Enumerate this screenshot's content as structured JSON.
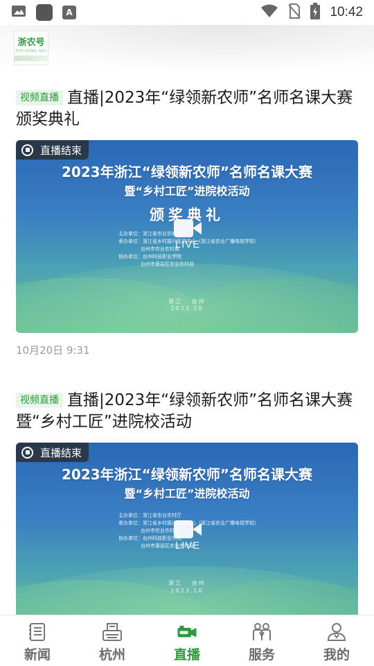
{
  "status_bar": {
    "time": "10:42",
    "icons": [
      "image-icon",
      "square-icon",
      "font-a-icon",
      "wifi-icon",
      "no-sim-icon",
      "battery-charging-icon"
    ],
    "icon_a_glyph": "A"
  },
  "header": {
    "logo_text": "浙农号",
    "logo_sub": "ZHE NONG HAO"
  },
  "feed": {
    "items": [
      {
        "tag": "视频直播",
        "title": "直播|2023年“绿领新农师”名师名课大赛颁奖典礼",
        "badge": "直播结束",
        "video": {
          "line1": "2023年浙江“绿领新农师”名师名课大赛",
          "line2": "暨“乡村工匠”进院校活动",
          "line3": "颁奖典礼",
          "org1": "主办单位：浙江省农业农村厅",
          "org2": "承办单位：浙江省乡村振兴促进中心（浙江省农业广播电视学校）",
          "org3": "台州市农业农村局",
          "org4": "协办单位：台州科技职业学院",
          "org5": "台州市黄岩区农业农村局",
          "place": "浙江 · 台州",
          "date": "2023.10",
          "live": "LIVE"
        },
        "date": "10月20日  9:31"
      },
      {
        "tag": "视频直播",
        "title": "直播|2023年“绿领新农师”名师名课大赛暨“乡村工匠”进院校活动",
        "badge": "直播结束",
        "video": {
          "line1": "2023年浙江“绿领新农师”名师名课大赛",
          "line2": "暨“乡村工匠”进院校活动",
          "org1": "主办单位：浙江省农业农村厅",
          "org2": "承办单位：浙江省乡村振兴促进中心（浙江省农业广播电视学校）",
          "org3": "台州市农业农村局",
          "org4": "协办单位：台州科技职业学院",
          "org5": "台州市黄岩区农业农村局",
          "place": "浙江 · 台州",
          "date": "2023.10",
          "live": "LIVE"
        }
      }
    ]
  },
  "nav": {
    "items": [
      {
        "label": "新闻",
        "icon": "newspaper-icon"
      },
      {
        "label": "杭州",
        "icon": "typewriter-icon"
      },
      {
        "label": "直播",
        "icon": "video-camera-icon",
        "active": true
      },
      {
        "label": "服务",
        "icon": "people-icon"
      },
      {
        "label": "我的",
        "icon": "person-icon"
      }
    ]
  },
  "colors": {
    "accent": "#2d9a3c",
    "tag_bg": "#e8f5ea",
    "nav_inactive": "#6b6b6b"
  }
}
